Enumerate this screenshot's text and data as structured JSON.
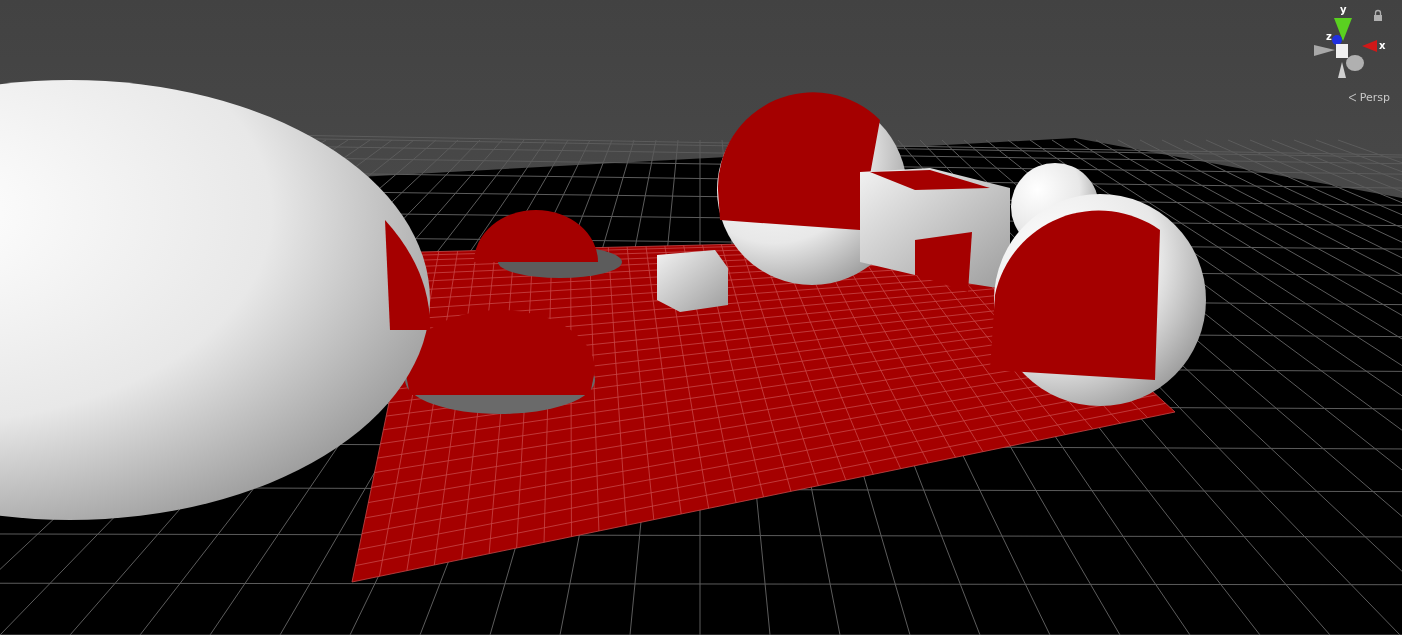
{
  "scene_view": {
    "projection": "Persp"
  },
  "gizmo": {
    "axis_labels": [
      {
        "kind": "up",
        "text": "y"
      },
      {
        "kind": "right",
        "text": "x"
      },
      {
        "kind": "forward",
        "text": "z"
      }
    ]
  }
}
